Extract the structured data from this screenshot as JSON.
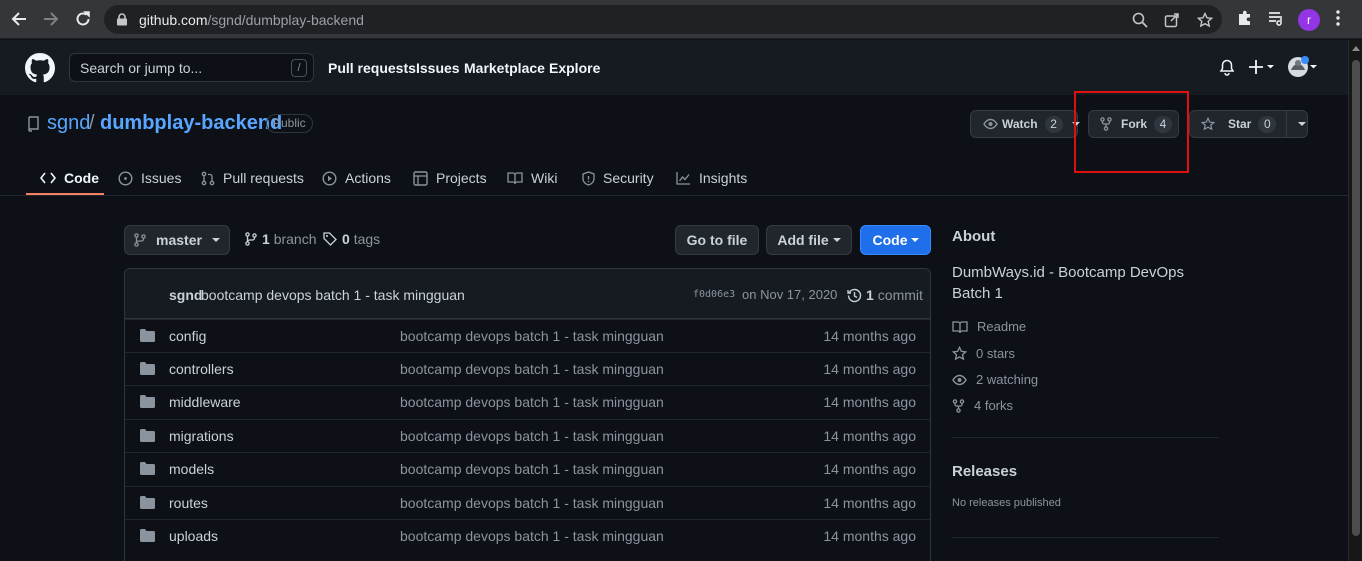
{
  "browser": {
    "url_host": "github.com",
    "url_path": "/sgnd/dumbplay-backend",
    "profile_initial": "r"
  },
  "header": {
    "search_placeholder": "Search or jump to...",
    "search_shortcut": "/",
    "nav": [
      "Pull requests",
      "Issues",
      "Marketplace",
      "Explore"
    ]
  },
  "repo": {
    "owner": "sgnd",
    "separator": "/",
    "name": "dumbplay-backend",
    "visibility": "Public",
    "watch_label": "Watch",
    "watch_count": "2",
    "fork_label": "Fork",
    "fork_count": "4",
    "star_label": "Star",
    "star_count": "0"
  },
  "tabs": [
    {
      "label": "Code",
      "icon": "code-icon",
      "active": true
    },
    {
      "label": "Issues",
      "icon": "issue-icon"
    },
    {
      "label": "Pull requests",
      "icon": "pull-request-icon"
    },
    {
      "label": "Actions",
      "icon": "play-icon"
    },
    {
      "label": "Projects",
      "icon": "table-icon"
    },
    {
      "label": "Wiki",
      "icon": "book-icon"
    },
    {
      "label": "Security",
      "icon": "shield-icon"
    },
    {
      "label": "Insights",
      "icon": "graph-icon"
    }
  ],
  "filenav": {
    "branch": "master",
    "branch_count": "1",
    "branch_label": "branch",
    "tag_count": "0",
    "tag_label": "tags",
    "go_to_file": "Go to file",
    "add_file": "Add file",
    "code_button": "Code"
  },
  "commit": {
    "author": "sgnd",
    "message": "bootcamp devops batch 1 - task mingguan",
    "sha": "f0d06e3",
    "date": "on Nov 17, 2020",
    "count": "1",
    "count_label": "commit"
  },
  "files": [
    {
      "name": "config",
      "message": "bootcamp devops batch 1 - task mingguan",
      "age": "14 months ago"
    },
    {
      "name": "controllers",
      "message": "bootcamp devops batch 1 - task mingguan",
      "age": "14 months ago"
    },
    {
      "name": "middleware",
      "message": "bootcamp devops batch 1 - task mingguan",
      "age": "14 months ago"
    },
    {
      "name": "migrations",
      "message": "bootcamp devops batch 1 - task mingguan",
      "age": "14 months ago"
    },
    {
      "name": "models",
      "message": "bootcamp devops batch 1 - task mingguan",
      "age": "14 months ago"
    },
    {
      "name": "routes",
      "message": "bootcamp devops batch 1 - task mingguan",
      "age": "14 months ago"
    },
    {
      "name": "uploads",
      "message": "bootcamp devops batch 1 - task mingguan",
      "age": "14 months ago"
    }
  ],
  "about": {
    "title": "About",
    "description": "DumbWays.id - Bootcamp DevOps Batch 1",
    "readme": "Readme",
    "stars": "0 stars",
    "watching": "2 watching",
    "forks": "4 forks"
  },
  "releases": {
    "title": "Releases",
    "empty": "No releases published"
  },
  "colors": {
    "accent_link": "#58a6ff",
    "primary_button": "#1f6feb",
    "tab_underline": "#f78166",
    "highlight_box": "#e01010"
  }
}
